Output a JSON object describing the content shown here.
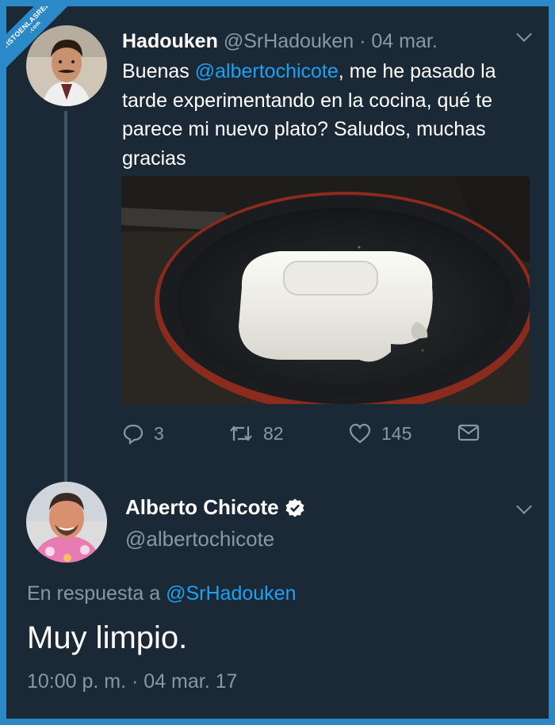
{
  "watermark": {
    "line1": "VISTOENLASREDES",
    "line2": ".com"
  },
  "tweet1": {
    "name": "Hadouken",
    "handle": "@SrHadouken",
    "separator": "·",
    "date": "04 mar.",
    "text_before": "Buenas ",
    "mention": "@albertochicote",
    "text_after": ", me he pasado la tarde experimentando en la cocina, qué te parece mi nuevo plato? Saludos, muchas gracias",
    "actions": {
      "replies": "3",
      "retweets": "82",
      "likes": "145"
    }
  },
  "tweet2": {
    "name": "Alberto Chicote",
    "handle": "@albertochicote",
    "reply_prefix": "En respuesta a ",
    "reply_mention": "@SrHadouken",
    "text": "Muy limpio.",
    "timestamp": "10:00 p. m. · 04 mar. 17"
  },
  "colors": {
    "background": "#1b2836",
    "accent": "#1da1f2",
    "muted": "#8899a6",
    "frame": "#2b89c8"
  },
  "icons": [
    "reply-icon",
    "retweet-icon",
    "like-icon",
    "dm-icon",
    "verified-icon",
    "chevron-down-icon"
  ]
}
